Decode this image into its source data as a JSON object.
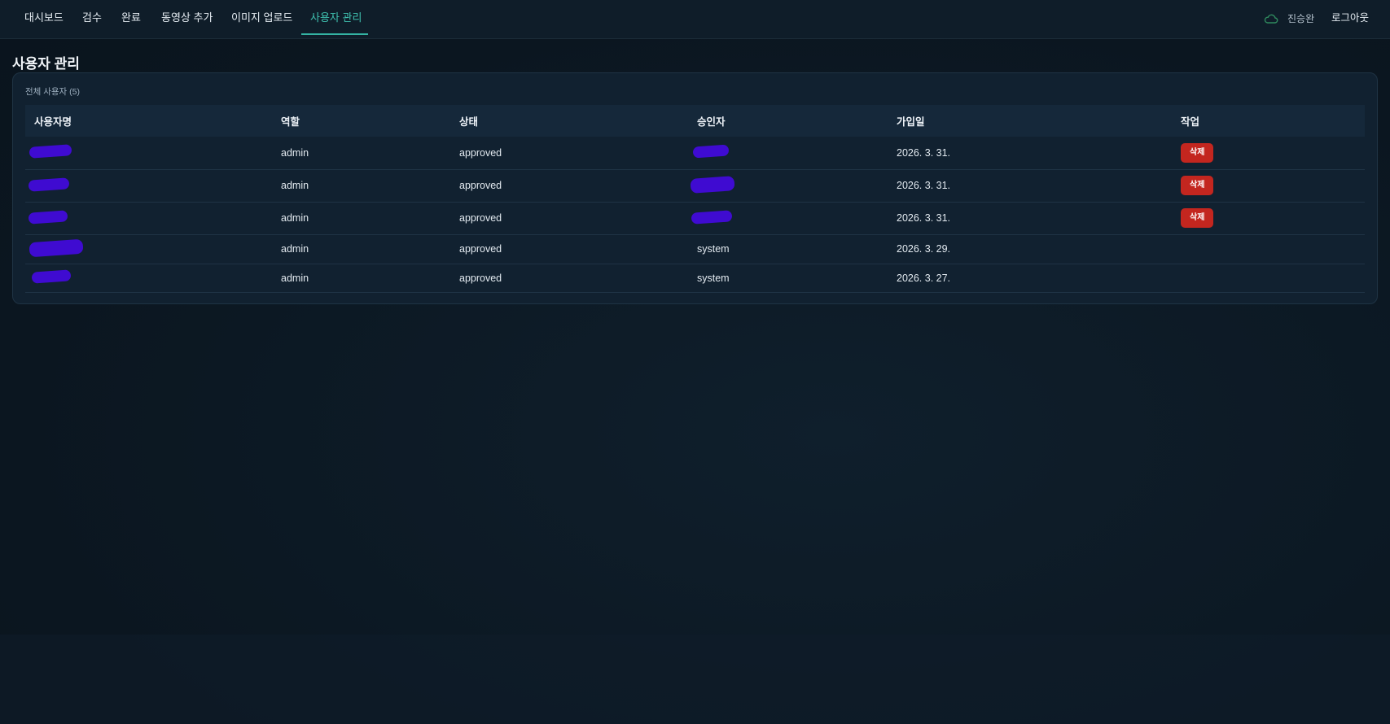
{
  "nav": {
    "items": [
      {
        "label": "대시보드"
      },
      {
        "label": "검수"
      },
      {
        "label": "완료"
      },
      {
        "label": "동영상 추가"
      },
      {
        "label": "이미지 업로드"
      },
      {
        "label": "사용자 관리"
      }
    ],
    "active_index": 5,
    "user_name": "진승완",
    "logout_label": "로그아웃"
  },
  "page": {
    "title": "사용자 관리",
    "caption": "전체 사용자 (5)"
  },
  "table": {
    "columns": [
      "사용자명",
      "역할",
      "상태",
      "승인자",
      "가입일",
      "작업"
    ],
    "rows": [
      {
        "role": "admin",
        "status": "approved",
        "approver": "",
        "joined": "2026. 3. 31.",
        "action": "삭제"
      },
      {
        "role": "admin",
        "status": "approved",
        "approver": "",
        "joined": "2026. 3. 31.",
        "action": "삭제"
      },
      {
        "role": "admin",
        "status": "approved",
        "approver": "",
        "joined": "2026. 3. 31.",
        "action": "삭제"
      },
      {
        "role": "admin",
        "status": "approved",
        "approver": "system",
        "joined": "2026. 3. 29.",
        "action": ""
      },
      {
        "role": "admin",
        "status": "approved",
        "approver": "system",
        "joined": "2026. 3. 27.",
        "action": ""
      }
    ]
  },
  "colors": {
    "accent": "#34b3a3",
    "delete": "#c3261f",
    "redaction": "#3f0bd1"
  }
}
